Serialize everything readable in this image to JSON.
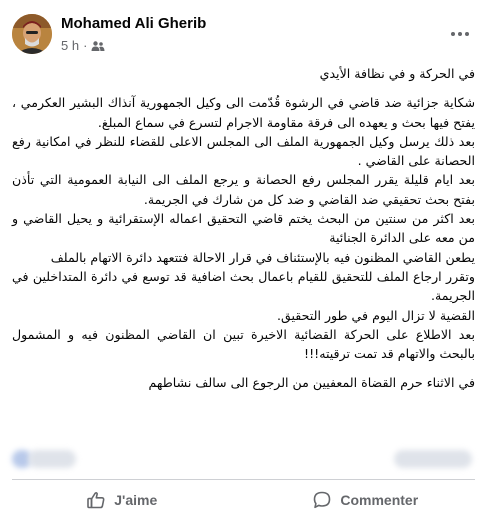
{
  "post": {
    "author": "Mohamed Ali Gherib",
    "time": "5 h",
    "separator": "·",
    "audience_icon": "friends-icon",
    "more_icon": "more-options-icon",
    "paragraphs": [
      "في الحركة و في نظافة الأيدي",
      "شكاية جزائية ضد قاضي في الرشوة قُدّمت الى وكيل الجمهورية آنذاك البشير العكرمي ، يفتح فيها بحث و يعهده الى فرقة مقاومة الاجرام لتسرع في سماع المبلغ.",
      "بعد ذلك يرسل وكيل الجمهورية الملف الى المجلس الاعلى للقضاء للنظر في امكانية رفع الحصانة على القاضي .",
      "بعد ايام قليلة يقرر المجلس رفع الحصانة و يرجع الملف الى النيابة العمومية التي تأذن بفتح بحث تحقيقي ضد القاضي و ضد كل من شارك في الجريمة.",
      "بعد اكثر من سنتين من البحث يختم قاضي التحقيق اعماله الإستقرائية و يحيل القاضي و من معه على الدائرة الجنائية",
      "يطعن القاضي المظنون فيه بالإستئناف في قرار الاحالة فتتعهد دائرة الاتهام بالملف",
      "وتقرر ارجاع الملف للتحقيق للقيام باعمال بحث اضافية قد توسع في دائرة المتداخلين في الجريمة.",
      "القضية لا تزال اليوم في طور التحقيق.",
      "بعد الاطلاع على الحركة القضائية الاخيرة تبين ان القاضي المظنون فيه و المشمول بالبحث والاتهام قد تمت ترقيته!!!",
      "في الاثناء حرم القضاة المعفيين من الرجوع الى سالف نشاطهم"
    ]
  },
  "actions": {
    "like_label": "J'aime",
    "like_icon": "thumbs-up-icon",
    "comment_label": "Commenter",
    "comment_icon": "comment-bubble-icon"
  },
  "colors": {
    "text": "#050505",
    "secondary": "#65676b",
    "divider": "#ced0d4"
  }
}
